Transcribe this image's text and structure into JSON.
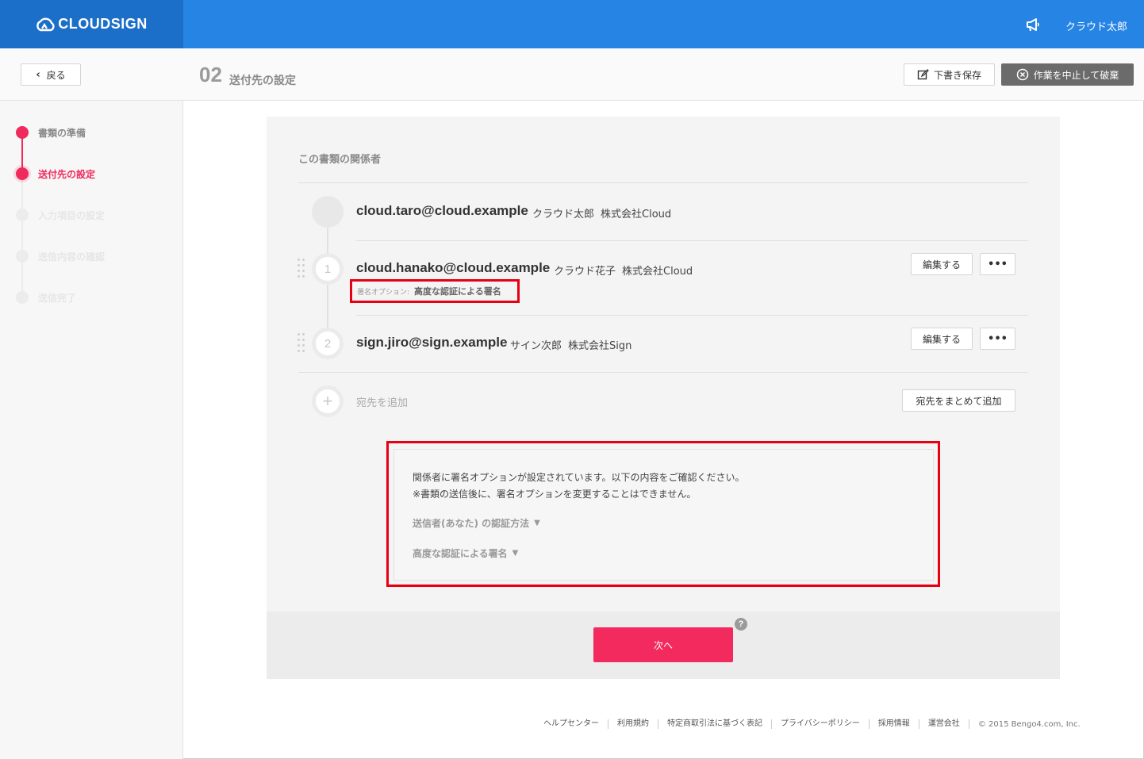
{
  "app": {
    "logo_text": "CLOUDSIGN",
    "user_name": "クラウド太郎"
  },
  "subheader": {
    "back_label": "戻る",
    "step_number": "02",
    "step_title": "送付先の設定",
    "draft_label": "下書き保存",
    "abort_label": "作業を中止して破棄"
  },
  "steps": [
    {
      "label": "書類の準備",
      "state": "done"
    },
    {
      "label": "送付先の設定",
      "state": "current"
    },
    {
      "label": "入力項目の設定",
      "state": "todo"
    },
    {
      "label": "送信内容の確認",
      "state": "todo"
    },
    {
      "label": "送信完了",
      "state": "todo"
    }
  ],
  "participants": {
    "section_title": "この書類の関係者",
    "sender": {
      "email": "cloud.taro@cloud.example",
      "name": "クラウド太郎",
      "company": "株式会社Cloud"
    },
    "recipients": [
      {
        "index": "1",
        "email": "cloud.hanako@cloud.example",
        "name": "クラウド花子",
        "company": "株式会社Cloud",
        "option_key": "署名オプション:",
        "option_value": "高度な認証による署名",
        "edit_label": "編集する",
        "more_label": "•••"
      },
      {
        "index": "2",
        "email": "sign.jiro@sign.example",
        "name": "サイン次郎",
        "company": "株式会社Sign",
        "edit_label": "編集する",
        "more_label": "•••"
      }
    ],
    "add_label": "宛先を追加",
    "add_icon": "+",
    "bulk_add_label": "宛先をまとめて追加"
  },
  "notice": {
    "line1": "関係者に署名オプションが設定されています。以下の内容をご確認ください。",
    "line2": "※書類の送信後に、署名オプションを変更することはできません。",
    "toggle1": "送信者(あなた) の認証方法",
    "toggle2": "高度な認証による署名"
  },
  "actions": {
    "next_label": "次へ",
    "help_label": "?"
  },
  "footer": {
    "links": [
      "ヘルプセンター",
      "利用規約",
      "特定商取引法に基づく表記",
      "プライバシーポリシー",
      "採用情報",
      "運営会社"
    ],
    "copyright": "© 2015 Bengo4.com, Inc."
  },
  "colors": {
    "header_blue": "#2584e4",
    "logo_blue": "#1b6fc8",
    "accent_pink": "#f02a5d",
    "highlight_red": "#e60012"
  }
}
